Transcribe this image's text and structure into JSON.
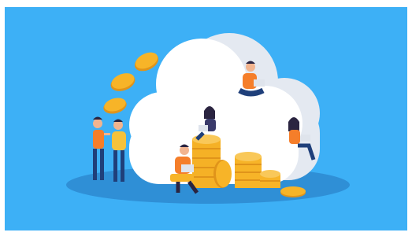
{
  "illustration": {
    "subject": "cloud-investing",
    "colors": {
      "frame": "#ffffff",
      "sky": "#3db0f6",
      "ground_shadow": "#2f8fd6",
      "cloud": "#ffffff",
      "cloud_shade": "#e4e9f1",
      "coin": "#f7b428",
      "coin_dark": "#e0941a",
      "shirt": "#f57e2a",
      "shirt_yellow": "#f5c23a",
      "pants": "#1f3f7a",
      "skin": "#f2b48f",
      "hair": "#2a2440",
      "laptop": "#dfe4ec"
    }
  }
}
